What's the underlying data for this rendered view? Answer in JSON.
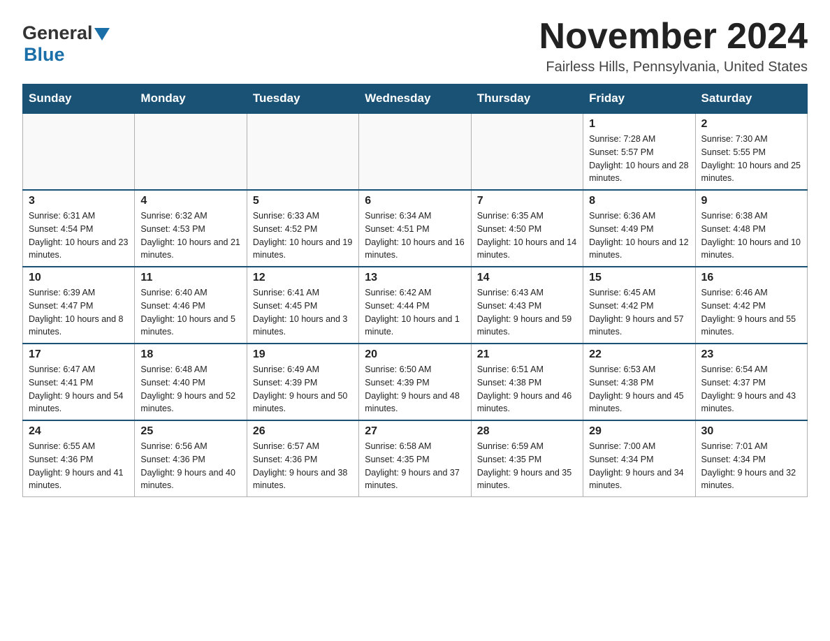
{
  "logo": {
    "general": "General",
    "blue": "Blue",
    "arrow": "▼"
  },
  "header": {
    "title": "November 2024",
    "location": "Fairless Hills, Pennsylvania, United States"
  },
  "weekdays": [
    "Sunday",
    "Monday",
    "Tuesday",
    "Wednesday",
    "Thursday",
    "Friday",
    "Saturday"
  ],
  "weeks": [
    [
      {
        "day": "",
        "info": ""
      },
      {
        "day": "",
        "info": ""
      },
      {
        "day": "",
        "info": ""
      },
      {
        "day": "",
        "info": ""
      },
      {
        "day": "",
        "info": ""
      },
      {
        "day": "1",
        "info": "Sunrise: 7:28 AM\nSunset: 5:57 PM\nDaylight: 10 hours and 28 minutes."
      },
      {
        "day": "2",
        "info": "Sunrise: 7:30 AM\nSunset: 5:55 PM\nDaylight: 10 hours and 25 minutes."
      }
    ],
    [
      {
        "day": "3",
        "info": "Sunrise: 6:31 AM\nSunset: 4:54 PM\nDaylight: 10 hours and 23 minutes."
      },
      {
        "day": "4",
        "info": "Sunrise: 6:32 AM\nSunset: 4:53 PM\nDaylight: 10 hours and 21 minutes."
      },
      {
        "day": "5",
        "info": "Sunrise: 6:33 AM\nSunset: 4:52 PM\nDaylight: 10 hours and 19 minutes."
      },
      {
        "day": "6",
        "info": "Sunrise: 6:34 AM\nSunset: 4:51 PM\nDaylight: 10 hours and 16 minutes."
      },
      {
        "day": "7",
        "info": "Sunrise: 6:35 AM\nSunset: 4:50 PM\nDaylight: 10 hours and 14 minutes."
      },
      {
        "day": "8",
        "info": "Sunrise: 6:36 AM\nSunset: 4:49 PM\nDaylight: 10 hours and 12 minutes."
      },
      {
        "day": "9",
        "info": "Sunrise: 6:38 AM\nSunset: 4:48 PM\nDaylight: 10 hours and 10 minutes."
      }
    ],
    [
      {
        "day": "10",
        "info": "Sunrise: 6:39 AM\nSunset: 4:47 PM\nDaylight: 10 hours and 8 minutes."
      },
      {
        "day": "11",
        "info": "Sunrise: 6:40 AM\nSunset: 4:46 PM\nDaylight: 10 hours and 5 minutes."
      },
      {
        "day": "12",
        "info": "Sunrise: 6:41 AM\nSunset: 4:45 PM\nDaylight: 10 hours and 3 minutes."
      },
      {
        "day": "13",
        "info": "Sunrise: 6:42 AM\nSunset: 4:44 PM\nDaylight: 10 hours and 1 minute."
      },
      {
        "day": "14",
        "info": "Sunrise: 6:43 AM\nSunset: 4:43 PM\nDaylight: 9 hours and 59 minutes."
      },
      {
        "day": "15",
        "info": "Sunrise: 6:45 AM\nSunset: 4:42 PM\nDaylight: 9 hours and 57 minutes."
      },
      {
        "day": "16",
        "info": "Sunrise: 6:46 AM\nSunset: 4:42 PM\nDaylight: 9 hours and 55 minutes."
      }
    ],
    [
      {
        "day": "17",
        "info": "Sunrise: 6:47 AM\nSunset: 4:41 PM\nDaylight: 9 hours and 54 minutes."
      },
      {
        "day": "18",
        "info": "Sunrise: 6:48 AM\nSunset: 4:40 PM\nDaylight: 9 hours and 52 minutes."
      },
      {
        "day": "19",
        "info": "Sunrise: 6:49 AM\nSunset: 4:39 PM\nDaylight: 9 hours and 50 minutes."
      },
      {
        "day": "20",
        "info": "Sunrise: 6:50 AM\nSunset: 4:39 PM\nDaylight: 9 hours and 48 minutes."
      },
      {
        "day": "21",
        "info": "Sunrise: 6:51 AM\nSunset: 4:38 PM\nDaylight: 9 hours and 46 minutes."
      },
      {
        "day": "22",
        "info": "Sunrise: 6:53 AM\nSunset: 4:38 PM\nDaylight: 9 hours and 45 minutes."
      },
      {
        "day": "23",
        "info": "Sunrise: 6:54 AM\nSunset: 4:37 PM\nDaylight: 9 hours and 43 minutes."
      }
    ],
    [
      {
        "day": "24",
        "info": "Sunrise: 6:55 AM\nSunset: 4:36 PM\nDaylight: 9 hours and 41 minutes."
      },
      {
        "day": "25",
        "info": "Sunrise: 6:56 AM\nSunset: 4:36 PM\nDaylight: 9 hours and 40 minutes."
      },
      {
        "day": "26",
        "info": "Sunrise: 6:57 AM\nSunset: 4:36 PM\nDaylight: 9 hours and 38 minutes."
      },
      {
        "day": "27",
        "info": "Sunrise: 6:58 AM\nSunset: 4:35 PM\nDaylight: 9 hours and 37 minutes."
      },
      {
        "day": "28",
        "info": "Sunrise: 6:59 AM\nSunset: 4:35 PM\nDaylight: 9 hours and 35 minutes."
      },
      {
        "day": "29",
        "info": "Sunrise: 7:00 AM\nSunset: 4:34 PM\nDaylight: 9 hours and 34 minutes."
      },
      {
        "day": "30",
        "info": "Sunrise: 7:01 AM\nSunset: 4:34 PM\nDaylight: 9 hours and 32 minutes."
      }
    ]
  ]
}
